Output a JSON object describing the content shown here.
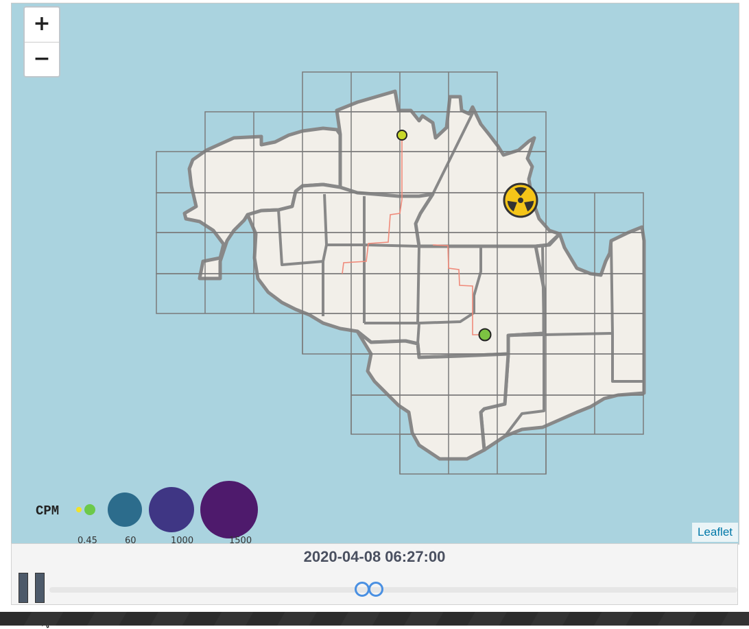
{
  "map": {
    "zoom_in_label": "+",
    "zoom_out_label": "−",
    "attribution": "Leaflet",
    "colors": {
      "water": "#aad3df",
      "land": "#f2efe9",
      "district_border": "#888888",
      "grid": "#808080",
      "track": "#f08a7a",
      "hazard": "#f5c518"
    },
    "markers": [
      {
        "name": "sensor-yellow",
        "color": "#c8d82a"
      },
      {
        "name": "sensor-green",
        "color": "#7cc242"
      }
    ],
    "hazard_icon": "radiation-icon"
  },
  "legend": {
    "title": "CPM",
    "entries": [
      {
        "label": "0.45",
        "color": "#f2e32a"
      },
      {
        "label": "",
        "color": "#6cc94a"
      },
      {
        "label": "60",
        "color": "#2c6c8c"
      },
      {
        "label": "1000",
        "color": "#3f3684"
      },
      {
        "label": "1500",
        "color": "#4e1a6c"
      }
    ]
  },
  "timeline": {
    "time": "2020-04-08 06:27:00",
    "play_state": "pause-icon",
    "slider_position": 0.47
  }
}
